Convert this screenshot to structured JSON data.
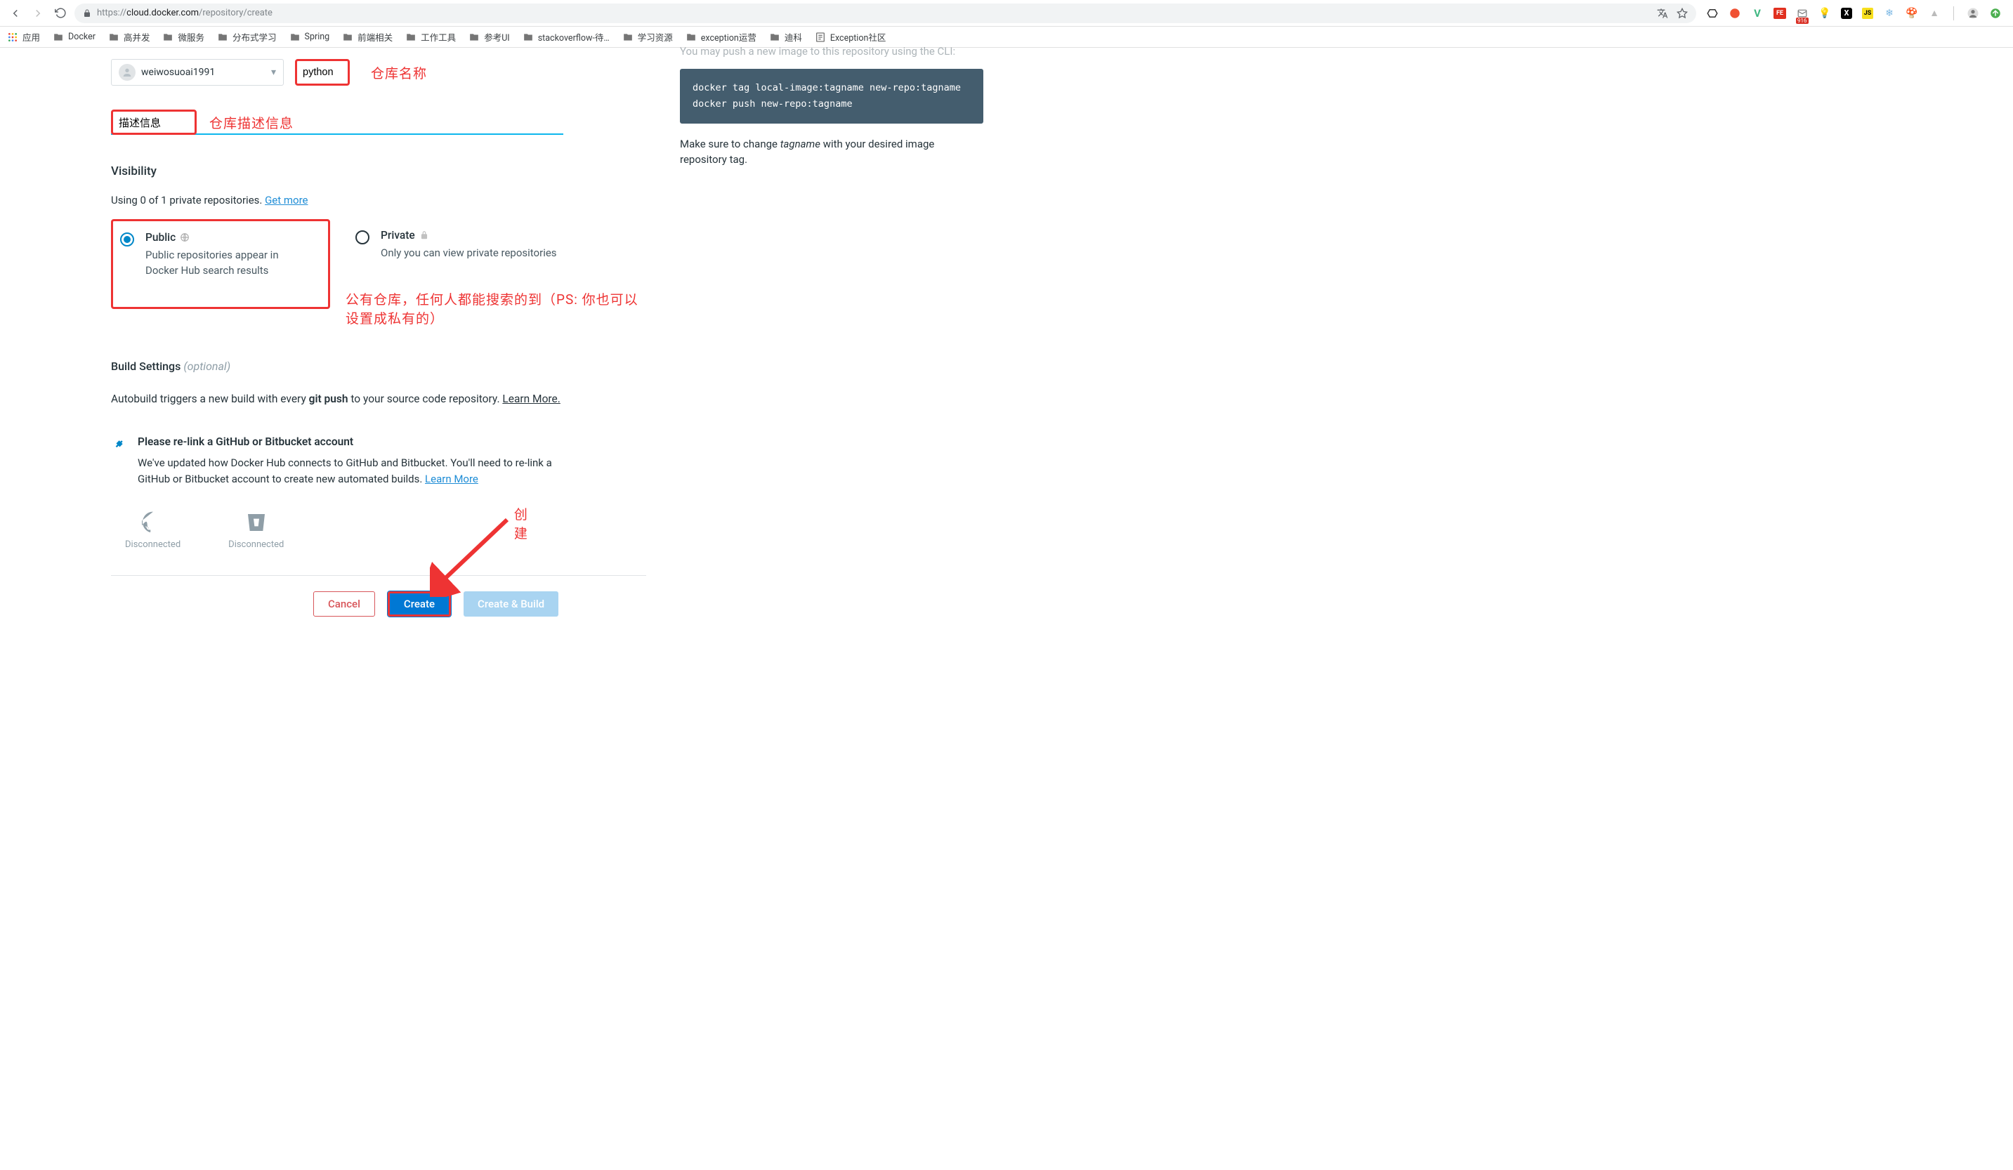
{
  "browser": {
    "url_prefix": "https://",
    "url_host": "cloud.docker.com",
    "url_path": "/repository/create"
  },
  "bookmarks": {
    "apps": "应用",
    "items": [
      "Docker",
      "高并发",
      "微服务",
      "分布式学习",
      "Spring",
      "前端相关",
      "工作工具",
      "参考UI",
      "stackoverflow-待…",
      "学习资源",
      "exception运营",
      "迪科",
      "Exception社区"
    ]
  },
  "namespace": {
    "value": "weiwosuoai1991"
  },
  "repo_name": {
    "value": "python"
  },
  "annotations": {
    "repo_name": "仓库名称",
    "description": "仓库描述信息",
    "public_note": "公有仓库，任何人都能搜索的到（PS: 你也可以设置成私有的）",
    "create": "创建"
  },
  "description": {
    "value": "描述信息"
  },
  "visibility": {
    "heading": "Visibility",
    "usage": "Using 0 of 1 private repositories. ",
    "get_more": "Get more",
    "public": {
      "title": "Public",
      "desc": "Public repositories appear in Docker Hub search results"
    },
    "private": {
      "title": "Private",
      "desc": "Only you can view private repositories"
    }
  },
  "build": {
    "heading": "Build Settings ",
    "optional": "(optional)",
    "autobuild_pre": "Autobuild triggers a new build with every ",
    "autobuild_bold": "git push",
    "autobuild_post": " to your source code repository. ",
    "learn_more": "Learn More."
  },
  "relink": {
    "title": "Please re-link a GitHub or Bitbucket account",
    "body": "We've updated how Docker Hub connects to GitHub and Bitbucket. You'll need to re-link a GitHub or Bitbucket account to create new automated builds. ",
    "learn_more": "Learn More"
  },
  "vcs": {
    "github": "Disconnected",
    "bitbucket": "Disconnected"
  },
  "buttons": {
    "cancel": "Cancel",
    "create": "Create",
    "create_build": "Create & Build"
  },
  "right": {
    "intro": "You may push a new image to this repository using the CLI:",
    "code_line1": "docker tag local-image:tagname new-repo:tagname",
    "code_line2": "docker push new-repo:tagname",
    "note_pre": "Make sure to change ",
    "note_em": "tagname",
    "note_post": " with your desired image repository tag."
  }
}
